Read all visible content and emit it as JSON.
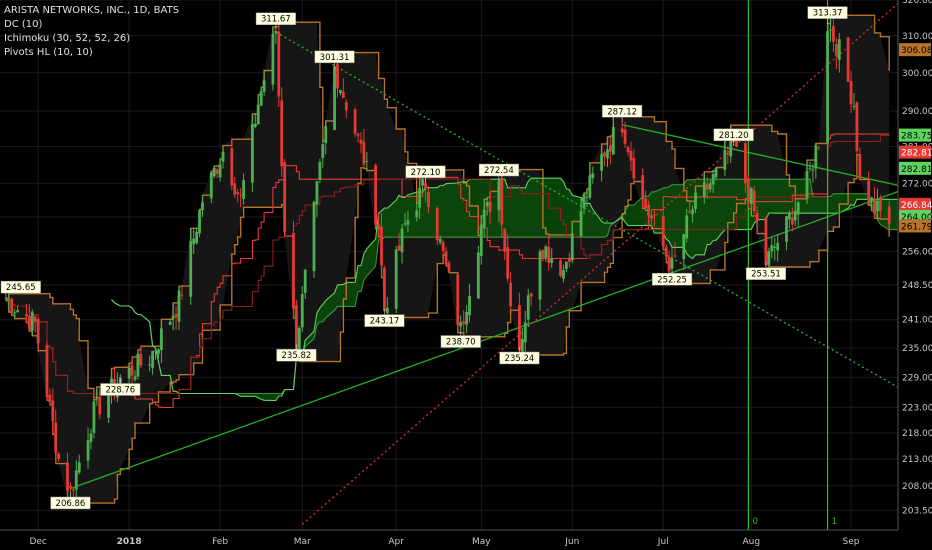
{
  "legend": {
    "symbol": "ARISTA NETWORKS, INC., 1D, BATS",
    "dc": "DC (10)",
    "ichimoku": "Ichimoku (30, 52, 52, 26)",
    "pivots": "Pivots HL (10, 10)"
  },
  "colors": {
    "background": "#000000",
    "candle_up": "#4caf50",
    "candle_down": "#e53935",
    "donchian": "#b8732a",
    "ichimoku_green": "#5fd35f",
    "ichimoku_red": "#e53935",
    "cloud_fill": "#0b4d0b",
    "trendline_green": "#22b022",
    "trendline_dotted_green": "#2ea82e",
    "trendline_dotted_red": "#d03030",
    "pivot_label_bg": "#ffffe0"
  },
  "chart_data": {
    "type": "candlestick",
    "y_scale": "log",
    "ylim": [
      200,
      320
    ],
    "xlim": [
      "2017-11-18",
      "2018-09-20"
    ],
    "y_ticks": [
      203.5,
      208.0,
      213.0,
      218.0,
      223.0,
      229.0,
      235.0,
      241.0,
      248.5,
      256.0,
      264.0,
      272.0,
      281.0,
      290.0,
      300.0,
      310.0,
      320.0
    ],
    "x_ticks": [
      {
        "label": "Dec",
        "date": "2017-12-01"
      },
      {
        "label": "2018",
        "date": "2018-01-01",
        "bold": true
      },
      {
        "label": "Feb",
        "date": "2018-02-01"
      },
      {
        "label": "Mar",
        "date": "2018-03-01"
      },
      {
        "label": "Apr",
        "date": "2018-04-02"
      },
      {
        "label": "May",
        "date": "2018-05-01"
      },
      {
        "label": "Jun",
        "date": "2018-06-01"
      },
      {
        "label": "Jul",
        "date": "2018-07-02"
      },
      {
        "label": "Aug",
        "date": "2018-08-01"
      },
      {
        "label": "Sep",
        "date": "2018-09-04"
      }
    ],
    "anchors": [
      {
        "d": "2017-11-20",
        "v": 245.65
      },
      {
        "d": "2017-11-30",
        "v": 240
      },
      {
        "d": "2017-12-08",
        "v": 213
      },
      {
        "d": "2017-12-12",
        "v": 206.86
      },
      {
        "d": "2017-12-20",
        "v": 222
      },
      {
        "d": "2017-12-29",
        "v": 228.76
      },
      {
        "d": "2018-01-08",
        "v": 233
      },
      {
        "d": "2018-01-18",
        "v": 245
      },
      {
        "d": "2018-01-26",
        "v": 268
      },
      {
        "d": "2018-02-02",
        "v": 280
      },
      {
        "d": "2018-02-08",
        "v": 268
      },
      {
        "d": "2018-02-14",
        "v": 292
      },
      {
        "d": "2018-02-20",
        "v": 311.67
      },
      {
        "d": "2018-02-23",
        "v": 262
      },
      {
        "d": "2018-02-27",
        "v": 235.82
      },
      {
        "d": "2018-03-06",
        "v": 270
      },
      {
        "d": "2018-03-12",
        "v": 301.31
      },
      {
        "d": "2018-03-16",
        "v": 292
      },
      {
        "d": "2018-03-22",
        "v": 278
      },
      {
        "d": "2018-03-27",
        "v": 262
      },
      {
        "d": "2018-03-29",
        "v": 243.17
      },
      {
        "d": "2018-04-05",
        "v": 262
      },
      {
        "d": "2018-04-12",
        "v": 272.1
      },
      {
        "d": "2018-04-18",
        "v": 255
      },
      {
        "d": "2018-04-24",
        "v": 238.7
      },
      {
        "d": "2018-05-01",
        "v": 262
      },
      {
        "d": "2018-05-07",
        "v": 272.54
      },
      {
        "d": "2018-05-10",
        "v": 250
      },
      {
        "d": "2018-05-14",
        "v": 235.24
      },
      {
        "d": "2018-05-21",
        "v": 258
      },
      {
        "d": "2018-05-29",
        "v": 252
      },
      {
        "d": "2018-06-05",
        "v": 268
      },
      {
        "d": "2018-06-12",
        "v": 280
      },
      {
        "d": "2018-06-18",
        "v": 287.12
      },
      {
        "d": "2018-06-25",
        "v": 268
      },
      {
        "d": "2018-06-29",
        "v": 262
      },
      {
        "d": "2018-07-05",
        "v": 252.25
      },
      {
        "d": "2018-07-12",
        "v": 266
      },
      {
        "d": "2018-07-20",
        "v": 274
      },
      {
        "d": "2018-07-26",
        "v": 281.2
      },
      {
        "d": "2018-08-01",
        "v": 268
      },
      {
        "d": "2018-08-06",
        "v": 253.51
      },
      {
        "d": "2018-08-13",
        "v": 262
      },
      {
        "d": "2018-08-20",
        "v": 272
      },
      {
        "d": "2018-08-24",
        "v": 283
      },
      {
        "d": "2018-08-27",
        "v": 313.37
      },
      {
        "d": "2018-08-31",
        "v": 306
      },
      {
        "d": "2018-09-05",
        "v": 292
      },
      {
        "d": "2018-09-07",
        "v": 272
      },
      {
        "d": "2018-09-12",
        "v": 266
      },
      {
        "d": "2018-09-17",
        "v": 263
      }
    ],
    "pivots": [
      {
        "label": "245.65",
        "d": "2017-11-20",
        "v": 245.65,
        "pos": "above"
      },
      {
        "label": "206.86",
        "d": "2017-12-12",
        "v": 206.86,
        "pos": "below"
      },
      {
        "label": "228.76",
        "d": "2017-12-29",
        "v": 228.76,
        "pos": "below"
      },
      {
        "label": "311.67",
        "d": "2018-02-20",
        "v": 311.67,
        "pos": "above"
      },
      {
        "label": "235.82",
        "d": "2018-02-27",
        "v": 235.82,
        "pos": "below"
      },
      {
        "label": "301.31",
        "d": "2018-03-12",
        "v": 301.31,
        "pos": "above"
      },
      {
        "label": "243.17",
        "d": "2018-03-29",
        "v": 243.17,
        "pos": "below"
      },
      {
        "label": "272.10",
        "d": "2018-04-12",
        "v": 272.1,
        "pos": "above"
      },
      {
        "label": "238.70",
        "d": "2018-04-24",
        "v": 238.7,
        "pos": "below"
      },
      {
        "label": "272.54",
        "d": "2018-05-07",
        "v": 272.54,
        "pos": "above"
      },
      {
        "label": "235.24",
        "d": "2018-05-14",
        "v": 235.24,
        "pos": "below"
      },
      {
        "label": "287.12",
        "d": "2018-06-18",
        "v": 287.12,
        "pos": "above"
      },
      {
        "label": "252.25",
        "d": "2018-07-05",
        "v": 252.25,
        "pos": "below"
      },
      {
        "label": "281.20",
        "d": "2018-07-26",
        "v": 281.2,
        "pos": "above"
      },
      {
        "label": "253.51",
        "d": "2018-08-06",
        "v": 253.51,
        "pos": "below"
      },
      {
        "label": "313.37",
        "d": "2018-08-27",
        "v": 313.37,
        "pos": "above"
      }
    ],
    "price_labels": [
      {
        "label": "306.08",
        "v": 306.08,
        "bg": "#b8732a",
        "fg": "#000"
      },
      {
        "label": "283.75",
        "v": 283.75,
        "bg": "#5fd35f",
        "fg": "#000"
      },
      {
        "label": "282.81",
        "v": 279.5,
        "bg": "#e53935",
        "fg": "#fff"
      },
      {
        "label": "282.81",
        "v": 275.5,
        "bg": "#5fd35f",
        "fg": "#000"
      },
      {
        "label": "266.84",
        "v": 266.84,
        "bg": "#e53935",
        "fg": "#fff"
      },
      {
        "label": "264.00",
        "v": 264.0,
        "bg": "#5fd35f",
        "fg": "#000"
      },
      {
        "label": "261.79",
        "v": 261.79,
        "bg": "#b8732a",
        "fg": "#000"
      }
    ],
    "trendlines": [
      {
        "name": "support",
        "from": {
          "d": "2017-12-12",
          "v": 207.5
        },
        "to": {
          "d": "2018-09-20",
          "v": 270
        },
        "style": "solid",
        "color": "#22b022"
      },
      {
        "name": "resistance-upper",
        "from": {
          "d": "2018-06-18",
          "v": 286.5
        },
        "to": {
          "d": "2018-09-20",
          "v": 271.5
        },
        "style": "solid",
        "color": "#22b022"
      },
      {
        "name": "resistance-falling",
        "from": {
          "d": "2018-02-20",
          "v": 311
        },
        "to": {
          "d": "2018-09-20",
          "v": 227
        },
        "style": "dotted",
        "color": "#2ea82e"
      },
      {
        "name": "rising-dotted",
        "from": {
          "d": "2018-03-01",
          "v": 201
        },
        "to": {
          "d": "2018-09-20",
          "v": 319
        },
        "style": "dotted",
        "color": "#d03030"
      }
    ],
    "vertical_markers": [
      {
        "label": "0",
        "d": "2018-07-31"
      },
      {
        "label": "1",
        "d": "2018-08-27"
      }
    ]
  }
}
